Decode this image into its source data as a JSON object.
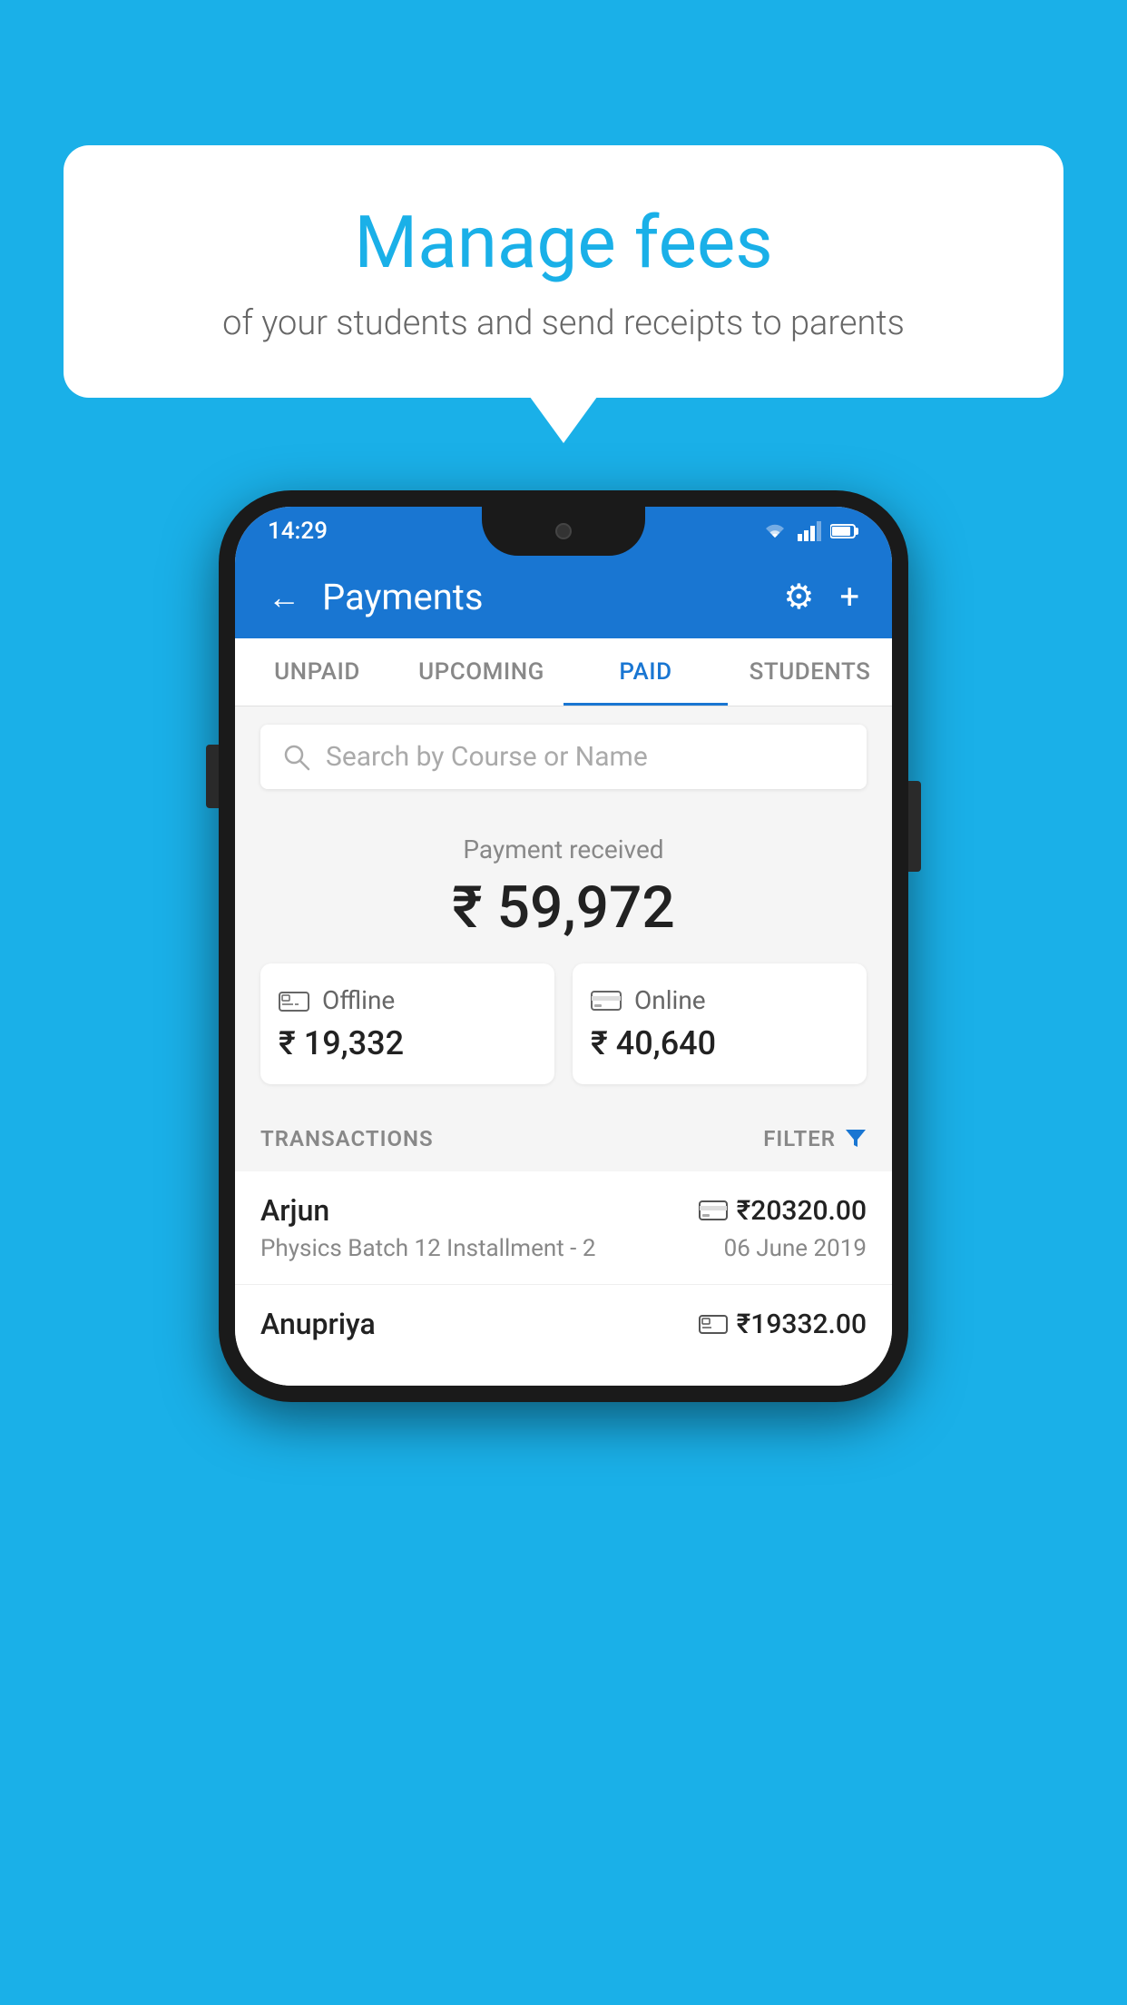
{
  "background_color": "#1ab0e8",
  "speech_bubble": {
    "heading": "Manage fees",
    "subtext": "of your students and send receipts to parents"
  },
  "phone": {
    "status_bar": {
      "time": "14:29",
      "wifi_icon": "▼",
      "signal_icon": "▲",
      "battery_icon": "▮"
    },
    "header": {
      "title": "Payments",
      "back_icon": "←",
      "settings_icon": "⚙",
      "add_icon": "+"
    },
    "tabs": [
      {
        "label": "UNPAID",
        "active": false
      },
      {
        "label": "UPCOMING",
        "active": false
      },
      {
        "label": "PAID",
        "active": true
      },
      {
        "label": "STUDENTS",
        "active": false
      }
    ],
    "search": {
      "placeholder": "Search by Course or Name",
      "search_icon": "🔍"
    },
    "payment_summary": {
      "label": "Payment received",
      "amount": "₹ 59,972",
      "offline": {
        "label": "Offline",
        "amount": "₹ 19,332"
      },
      "online": {
        "label": "Online",
        "amount": "₹ 40,640"
      }
    },
    "transactions_section": {
      "label": "TRANSACTIONS",
      "filter_label": "FILTER"
    },
    "transactions": [
      {
        "name": "Arjun",
        "course": "Physics Batch 12 Installment - 2",
        "amount": "₹20320.00",
        "date": "06 June 2019",
        "payment_type": "online"
      },
      {
        "name": "Anupriya",
        "course": "",
        "amount": "₹19332.00",
        "date": "",
        "payment_type": "offline"
      }
    ]
  }
}
